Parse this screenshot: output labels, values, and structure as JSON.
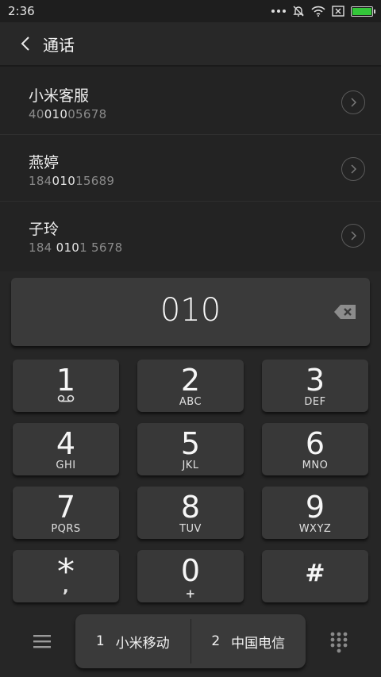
{
  "status_bar": {
    "time": "2:36",
    "icons": [
      "more-dots-icon",
      "bell-muted-icon",
      "wifi-icon",
      "sim-off-icon",
      "battery-icon"
    ],
    "battery_color": "#34c73a"
  },
  "header": {
    "back_icon": "chevron-left-icon",
    "title": "通话"
  },
  "results": [
    {
      "name": "小米客服",
      "number_pre": "40",
      "number_match": "010",
      "number_post": "05678"
    },
    {
      "name": "燕婷",
      "number_pre": "184",
      "number_match": "010",
      "number_post": "15689"
    },
    {
      "name": "子玲",
      "number_pre": "184 ",
      "number_match": "010",
      "number_post": "1 5678"
    }
  ],
  "dialer": {
    "input_value": "010",
    "backspace_icon": "backspace-icon"
  },
  "keys": [
    {
      "digit": "1",
      "letters": "",
      "sub_icon": "voicemail-icon"
    },
    {
      "digit": "2",
      "letters": "ABC"
    },
    {
      "digit": "3",
      "letters": "DEF"
    },
    {
      "digit": "4",
      "letters": "GHI"
    },
    {
      "digit": "5",
      "letters": "JKL"
    },
    {
      "digit": "6",
      "letters": "MNO"
    },
    {
      "digit": "7",
      "letters": "PQRS"
    },
    {
      "digit": "8",
      "letters": "TUV"
    },
    {
      "digit": "9",
      "letters": "WXYZ"
    },
    {
      "digit": "*",
      "letters": ","
    },
    {
      "digit": "0",
      "letters": "+"
    },
    {
      "digit": "#",
      "letters": ""
    }
  ],
  "bottom_bar": {
    "menu_icon": "menu-icon",
    "sim1_number": "1",
    "sim1_label": "小米移动",
    "sim2_number": "2",
    "sim2_label": "中国电信",
    "dialpad_icon": "dialpad-icon"
  },
  "colors": {
    "background": "#232323",
    "key": "#383838",
    "text": "#ffffff",
    "muted_text": "#8a8a8a"
  }
}
